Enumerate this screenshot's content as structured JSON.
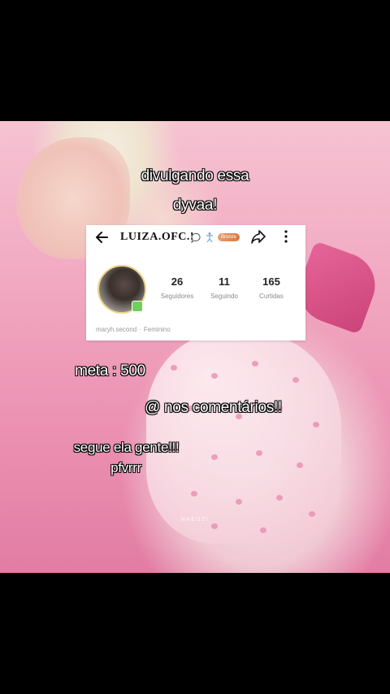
{
  "overlay": {
    "line1": "divulgando essa",
    "line2": "dyvaa!",
    "meta": "meta : 500",
    "mentions": "@ nos comentários!!",
    "follow1": "segue ela gente!!!",
    "follow2": "pfvrrr"
  },
  "profile": {
    "username": "LUIZA.OFC.!",
    "badge": "Bronze",
    "stats": [
      {
        "value": "26",
        "label": "Seguidores"
      },
      {
        "value": "11",
        "label": "Seguindo"
      },
      {
        "value": "165",
        "label": "Curtidas"
      }
    ],
    "handle": "maryh.second",
    "gender": "Feminino"
  },
  "watermark": "NAEUZI",
  "colors": {
    "background": "#000000",
    "pink": "#f1a9c1",
    "badge": "#d9773f"
  }
}
